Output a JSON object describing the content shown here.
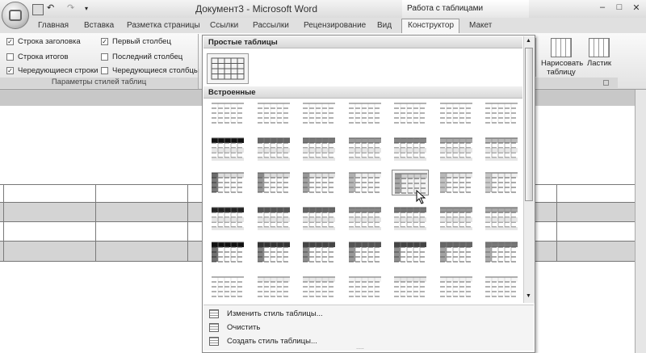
{
  "window": {
    "title": "Документ3 - Microsoft Word",
    "contextual_title": "Работа с таблицами",
    "buttons": [
      "–",
      "□",
      "✕"
    ]
  },
  "tabs": [
    {
      "label": "Главная"
    },
    {
      "label": "Вставка"
    },
    {
      "label": "Разметка страницы"
    },
    {
      "label": "Ссылки"
    },
    {
      "label": "Рассылки"
    },
    {
      "label": "Рецензирование"
    },
    {
      "label": "Вид"
    },
    {
      "label": "Конструктор",
      "active": true
    },
    {
      "label": "Макет"
    }
  ],
  "style_options": {
    "group_label": "Параметры стилей таблиц",
    "checkboxes": [
      {
        "label": "Строка заголовка",
        "checked": true
      },
      {
        "label": "Строка итогов",
        "checked": false
      },
      {
        "label": "Чередующиеся строки",
        "checked": true
      },
      {
        "label": "Первый столбец",
        "checked": true
      },
      {
        "label": "Последний столбец",
        "checked": false
      },
      {
        "label": "Чередующиеся столбцы",
        "checked": false
      }
    ]
  },
  "draw_tools": {
    "draw_table": "Нарисовать таблицу",
    "eraser": "Ластик"
  },
  "gallery": {
    "section_plain": "Простые таблицы",
    "section_builtin": "Встроенные",
    "menu": [
      {
        "label": "Изменить стиль таблицы...",
        "icon": "table-edit-icon"
      },
      {
        "label": "Очистить",
        "icon": "table-clear-icon"
      },
      {
        "label": "Создать стиль таблицы...",
        "icon": "table-new-icon"
      }
    ],
    "grip": "....."
  },
  "colors": {
    "accent": "#d9d9d9",
    "ribbon": "#eeeeee"
  }
}
